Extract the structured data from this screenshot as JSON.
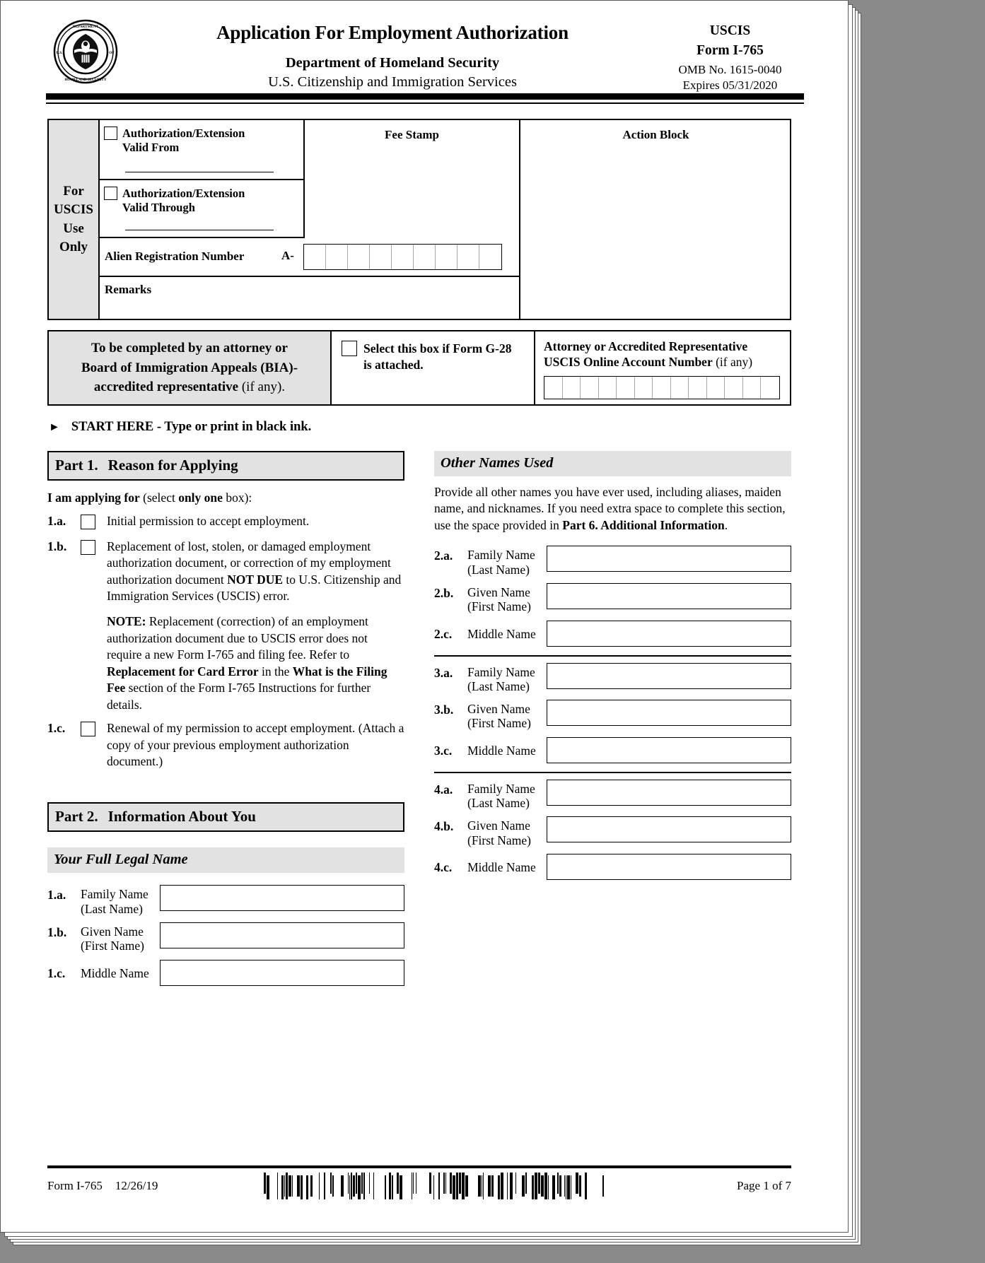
{
  "header": {
    "seal_alt": "dhs-seal",
    "title": "Application For Employment Authorization",
    "dept": "Department of Homeland Security",
    "agency": "U.S. Citizenship and Immigration Services",
    "uscis": "USCIS",
    "form": "Form I-765",
    "omb": "OMB No. 1615-0040",
    "expires": "Expires 05/31/2020"
  },
  "uscis_block": {
    "side_label": "For\nUSCIS\nUse\nOnly",
    "side_lines": [
      "For",
      "USCIS",
      "Use",
      "Only"
    ],
    "valid_from": "Authorization/Extension\nValid From",
    "valid_from_l1": "Authorization/Extension",
    "valid_from_l2": "Valid From",
    "valid_through_l1": "Authorization/Extension",
    "valid_through_l2": "Valid Through",
    "fee_stamp": "Fee Stamp",
    "action_block": "Action Block",
    "alien_label": "Alien Registration Number",
    "alien_prefix": "A-",
    "alien_cells": 9,
    "remarks": "Remarks"
  },
  "attorney_block": {
    "left_l1": "To be completed by an attorney or",
    "left_l2": "Board of Immigration Appeals (BIA)-",
    "left_l3_bold": "accredited representative",
    "left_l3_rest": " (if any).",
    "g28_l1": "Select this box if Form G-28",
    "g28_l2": "is attached.",
    "acct_l1": "Attorney or Accredited Representative",
    "acct_l2_bold": "USCIS Online Account Number",
    "acct_l2_rest": " (if any)",
    "acct_cells": 13
  },
  "start_here": {
    "arrow": "►",
    "text": "START HERE - Type or print in black ink."
  },
  "part1": {
    "number": "Part 1.",
    "title": "Reason for Applying",
    "lead_bold": "I am applying for",
    "lead_mid": " (select ",
    "lead_bold2": "only one",
    "lead_end": " box):",
    "items": [
      {
        "num": "1.a.",
        "text": "Initial permission to accept employment."
      },
      {
        "num": "1.b.",
        "text_p1": "Replacement of lost, stolen, or damaged employment authorization document, or correction of my employment authorization document ",
        "text_bold": "NOT DUE",
        "text_p2": " to U.S. Citizenship and Immigration Services (USCIS) error.",
        "note_label": "NOTE:",
        "note_p1": "  Replacement (correction) of an employment authorization document due to USCIS error does not require a new Form I-765 and filing fee.  Refer to ",
        "note_b1": "Replacement for Card Error",
        "note_p2": " in the ",
        "note_b2": "What is the Filing Fee",
        "note_p3": " section of the Form I-765 Instructions for further details."
      },
      {
        "num": "1.c.",
        "text": "Renewal of my permission to accept employment. (Attach a copy of your previous employment authorization document.)"
      }
    ]
  },
  "part2": {
    "number": "Part 2.",
    "title": "Information About You",
    "full_legal_name": "Your Full Legal Name",
    "fields": [
      {
        "num": "1.a.",
        "l1": "Family Name",
        "l2": "(Last Name)",
        "value": ""
      },
      {
        "num": "1.b.",
        "l1": "Given Name",
        "l2": "(First Name)",
        "value": ""
      },
      {
        "num": "1.c.",
        "l1": "Middle Name",
        "l2": "",
        "value": ""
      }
    ]
  },
  "other_names": {
    "title": "Other Names Used",
    "para_p1": "Provide all other names you have ever used, including aliases, maiden name, and nicknames.  If you need extra space to complete this section, use the space provided in ",
    "para_b1": "Part 6. Additional Information",
    "para_p2": ".",
    "groups": [
      {
        "fields": [
          {
            "num": "2.a.",
            "l1": "Family Name",
            "l2": "(Last Name)",
            "value": ""
          },
          {
            "num": "2.b.",
            "l1": "Given Name",
            "l2": "(First Name)",
            "value": ""
          },
          {
            "num": "2.c.",
            "l1": "Middle Name",
            "l2": "",
            "value": ""
          }
        ]
      },
      {
        "fields": [
          {
            "num": "3.a.",
            "l1": "Family Name",
            "l2": "(Last Name)",
            "value": ""
          },
          {
            "num": "3.b.",
            "l1": "Given Name",
            "l2": "(First Name)",
            "value": ""
          },
          {
            "num": "3.c.",
            "l1": "Middle Name",
            "l2": "",
            "value": ""
          }
        ]
      },
      {
        "fields": [
          {
            "num": "4.a.",
            "l1": "Family Name",
            "l2": "(Last Name)",
            "value": ""
          },
          {
            "num": "4.b.",
            "l1": "Given Name",
            "l2": "(First Name)",
            "value": ""
          },
          {
            "num": "4.c.",
            "l1": "Middle Name",
            "l2": "",
            "value": ""
          }
        ]
      }
    ]
  },
  "footer": {
    "form_name": "Form I-765",
    "form_date": "12/26/19",
    "page": "Page 1 of 7",
    "barcode_alt": "barcode"
  },
  "colors": {
    "page_bg": "#ffffff",
    "viewer_bg": "#8a8a8a",
    "shade": "#e2e2e2",
    "rule": "#000000"
  }
}
